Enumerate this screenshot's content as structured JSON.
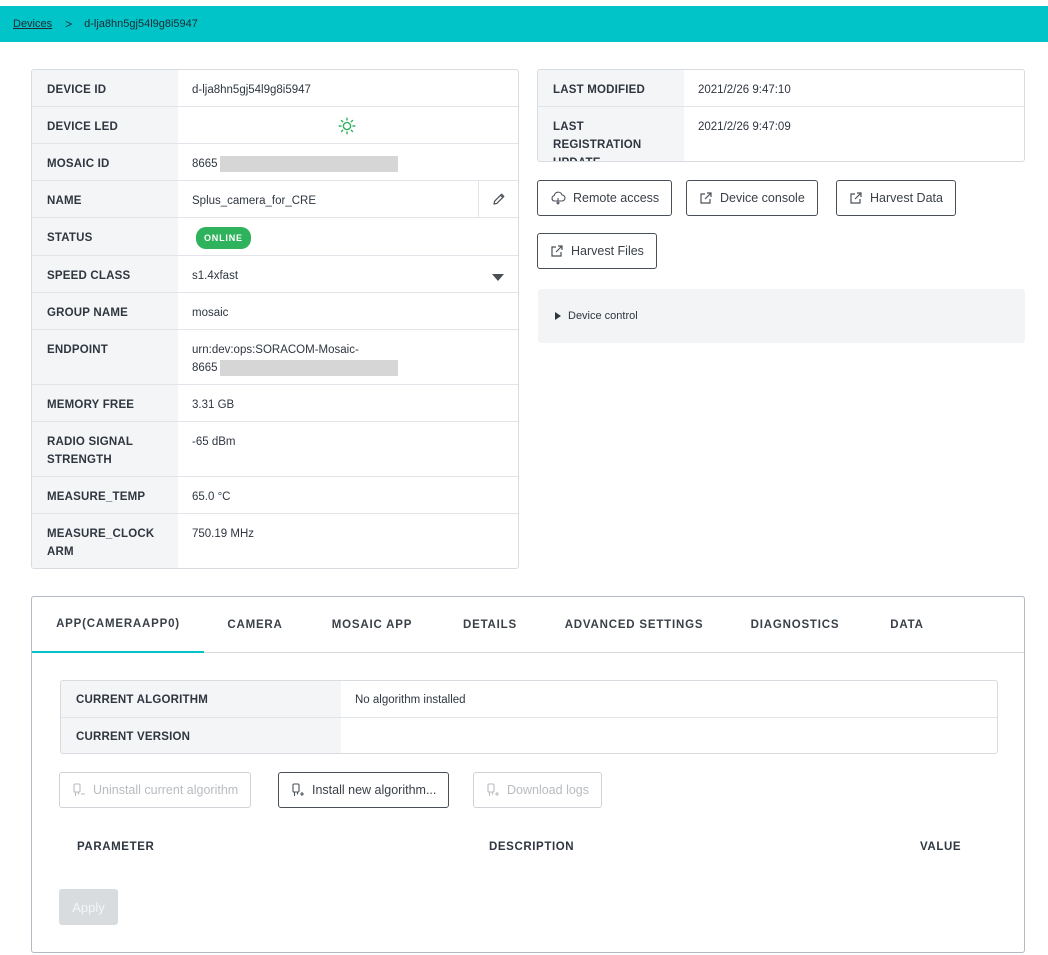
{
  "breadcrumb": {
    "devices_link": "Devices",
    "separator": ">",
    "current": "d-lja8hn5gj54l9g8i5947"
  },
  "device_info": {
    "rows": [
      {
        "key": "DEVICE ID",
        "value": "d-lja8hn5gj54l9g8i5947"
      },
      {
        "key": "DEVICE LED",
        "value": "",
        "icon": "sun-led-icon",
        "icon_color": "#2fb25c"
      },
      {
        "key": "MOSAIC ID",
        "value": "8665"
      },
      {
        "key": "NAME",
        "value": "Splus_camera_for_CRE"
      },
      {
        "key": "STATUS",
        "value": "ONLINE"
      },
      {
        "key": "SPEED CLASS",
        "value": "s1.4xfast"
      },
      {
        "key": "GROUP NAME",
        "value": "mosaic"
      },
      {
        "key": "ENDPOINT",
        "value": "urn:dev:ops:SORACOM-Mosaic-",
        "value_line2": "8665"
      },
      {
        "key": "MEMORY FREE",
        "value": "3.31 GB"
      },
      {
        "key": "RADIO SIGNAL STRENGTH",
        "value": "-65 dBm"
      },
      {
        "key": "MEASURE_TEMP",
        "value": "65.0 °C"
      },
      {
        "key": "MEASURE_CLOCK ARM",
        "value": "750.19 MHz"
      }
    ]
  },
  "modified_info": {
    "rows": [
      {
        "key": "LAST MODIFIED",
        "value": "2021/2/26 9:47:10"
      },
      {
        "key": "LAST REGISTRATION UPDATE",
        "value": "2021/2/26 9:47:09"
      }
    ]
  },
  "actions": {
    "remote_access": "Remote access",
    "device_console": "Device console",
    "harvest_data": "Harvest Data",
    "harvest_files": "Harvest Files"
  },
  "device_control": {
    "label": "Device control"
  },
  "tabs": [
    {
      "label": "APP(CAMERAAPP0)",
      "active": true
    },
    {
      "label": "CAMERA"
    },
    {
      "label": "MOSAIC APP"
    },
    {
      "label": "DETAILS"
    },
    {
      "label": "ADVANCED SETTINGS"
    },
    {
      "label": "DIAGNOSTICS"
    },
    {
      "label": "DATA"
    }
  ],
  "algorithm": {
    "rows": [
      {
        "key": "CURRENT ALGORITHM",
        "value": "No algorithm installed"
      },
      {
        "key": "CURRENT VERSION",
        "value": ""
      }
    ],
    "uninstall_label": "Uninstall current algorithm",
    "install_label": "Install new algorithm...",
    "download_logs_label": "Download logs"
  },
  "parameters": {
    "col_parameter": "PARAMETER",
    "col_description": "DESCRIPTION",
    "col_value": "VALUE"
  },
  "apply_label": "Apply",
  "colors": {
    "accent": "#00c4c8",
    "online": "#2fb25c"
  }
}
